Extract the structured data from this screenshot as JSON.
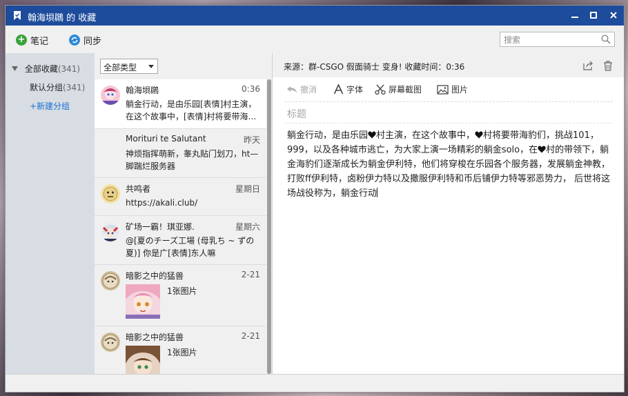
{
  "window": {
    "title": "翰海垻鸊 的 收藏",
    "controls": [
      "minimize",
      "maximize",
      "close"
    ]
  },
  "toolbar": {
    "note_label": "笔记",
    "sync_label": "同步",
    "search_placeholder": "搜索"
  },
  "sidebar": {
    "all_label": "全部收藏",
    "all_count": "(341)",
    "default_label": "默认分组",
    "default_count": "(341)",
    "new_group_label": "+新建分组"
  },
  "list": {
    "filter_value": "全部类型",
    "items": [
      {
        "name": "翰海垻鸊",
        "time": "0:36",
        "excerpt": "躺金行动，是由乐园[表情]村主演，在这个故事中，[表情]村将要带海…"
      },
      {
        "name": "Morituri te Salutant",
        "time": "昨天",
        "excerpt": "神烦指挥萌新，睾丸贴门划刀，ht—脚踹烂服务器"
      },
      {
        "name": "共鸣者",
        "time": "星期日",
        "excerpt": "https://akali.club/"
      },
      {
        "name": "矿场一霸！琪亚娜.",
        "time": "星期六",
        "excerpt": "@[夏のチーズ工場 (母乳ち ~ ずの夏)] 你是广[表情]东人嘛"
      },
      {
        "name": "暗影之中的猛兽",
        "time": "2-21",
        "image_label": "1张图片"
      },
      {
        "name": "暗影之中的猛兽",
        "time": "2-21",
        "image_label": "1张图片"
      }
    ]
  },
  "editor": {
    "source_text": "来源：群-CSGO 假面骑士 变身!   收藏时间：0:36",
    "tools": {
      "undo": "撤消",
      "font": "字体",
      "screenshot": "屏幕截图",
      "image": "图片"
    },
    "title_placeholder": "标题",
    "body_before": "躺金行动，是由乐园",
    "body_a": "村主演，在这个故事中，",
    "body_b": "村将要带海豹们，挑战101，999，以及各种城市逃亡，为大家上演一场精彩的躺金solo，在",
    "body_c": "村的带领下，躺金海豹们逐渐成长为躺金伊利特，他们将穿梭在乐园各个服务器，发展躺金神教，打败ff伊利特，卤粉伊力特以及撒服伊利特和币后铺伊力特等邪恶势力， 后世将这场战役称为，躺金行动"
  },
  "icons": {
    "window": "bookmark-icon",
    "note": "plus-circle-icon",
    "sync": "sync-icon",
    "search": "magnifier-icon",
    "share": "share-icon",
    "delete": "trash-icon",
    "heart": "heart-icon"
  },
  "colors": {
    "titlebar": "#1e4c9c",
    "accent_green": "#3aa23a",
    "accent_blue": "#2f8ad6",
    "link_blue": "#1d6fd6"
  }
}
